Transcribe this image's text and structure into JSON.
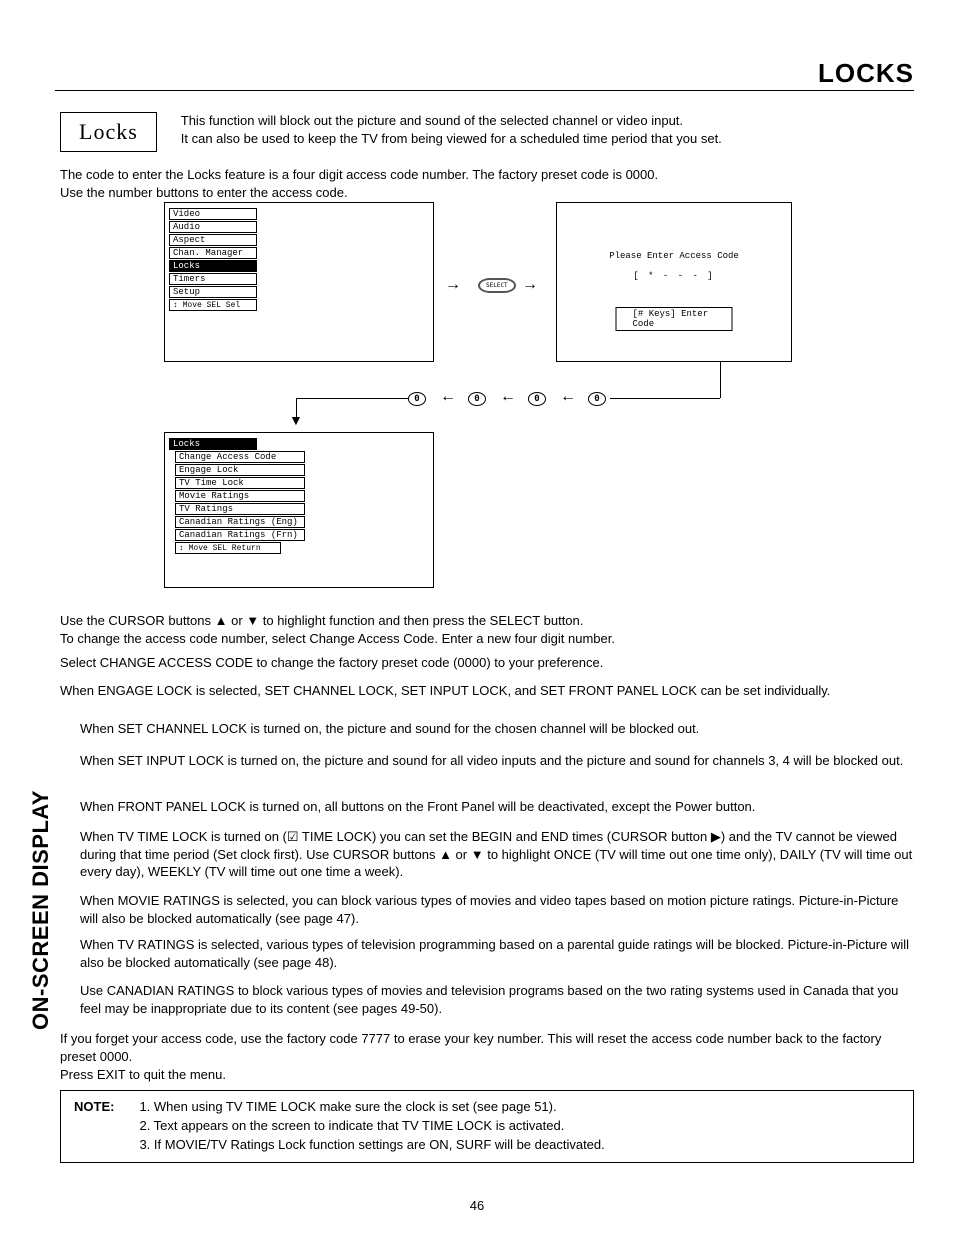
{
  "header": {
    "title": "LOCKS"
  },
  "sidebar": {
    "label": "ON-SCREEN DISPLAY"
  },
  "section": {
    "title": "Locks"
  },
  "intro": {
    "line1": "This function will block out the picture and sound of the selected channel or video input.",
    "line2": "It can also be used to keep the TV from being viewed for a scheduled time period that you set."
  },
  "para1": {
    "l1": "The code to enter the Locks feature is a four digit access code number.  The factory preset code is 0000.",
    "l2": "Use the number buttons to enter the access code."
  },
  "osd1": {
    "items": [
      "Video",
      "Audio",
      "Aspect",
      "Chan. Manager",
      "Locks",
      "Timers",
      "Setup"
    ],
    "hint": "↕ Move  SEL  Sel",
    "selected": "Locks"
  },
  "select_btn": "SELECT",
  "access_panel": {
    "prompt": "Please Enter Access Code",
    "mask": "[ * - - - ]",
    "hint": "[# Keys] Enter Code"
  },
  "zeros": [
    "0",
    "0",
    "0",
    "0"
  ],
  "osd2": {
    "title": "Locks",
    "items": [
      "Change Access Code",
      "Engage Lock",
      "TV Time Lock",
      "Movie Ratings",
      "TV Ratings",
      "Canadian Ratings (Eng)",
      "Canadian Ratings (Frn)"
    ],
    "hint": "↕ Move  SEL  Return"
  },
  "body": {
    "p2a": "Use the CURSOR buttons ▲ or ▼ to highlight function and then press the SELECT button.",
    "p2b": "To change the access code number, select Change Access Code.  Enter a new four digit number.",
    "p3": "Select CHANGE ACCESS CODE to change the factory preset code (0000) to your preference.",
    "p4": "When ENGAGE LOCK is selected, SET CHANNEL LOCK, SET INPUT LOCK, and SET FRONT PANEL LOCK can be set individually.",
    "p5": "When SET CHANNEL LOCK is turned on, the picture and sound for the chosen channel will be blocked out.",
    "p6": "When SET INPUT LOCK is turned on, the picture and sound for all video inputs and the picture and sound for channels 3, 4 will be blocked out.",
    "p7": "When FRONT PANEL LOCK is turned on, all buttons on the Front Panel will be deactivated, except the Power button.",
    "p8": "When TV TIME LOCK is turned on (☑ TIME LOCK) you can set the BEGIN and END times (CURSOR button ▶) and the TV cannot be viewed during that time period (Set clock first). Use CURSOR buttons ▲ or ▼ to highlight ONCE (TV will time out one time only), DAILY (TV will time out every day), WEEKLY (TV will time out one time a week).",
    "p9": "When MOVIE RATINGS is selected, you can block various types of movies and video tapes based on motion picture ratings.  Picture-in-Picture will also be blocked automatically (see page 47).",
    "p10": "When TV RATINGS is selected, various types of television programming based on a parental guide ratings will be blocked.  Picture-in-Picture will also be blocked automatically (see page 48).",
    "p11": "Use CANADIAN RATINGS to block various types of movies and television programs based on the two rating systems used in Canada that you feel may be inappropriate due to its content (see pages 49-50).",
    "p12": "If you forget your access code, use the factory code 7777 to erase your key number. This will reset the access code number back to the factory preset 0000.",
    "p13": "Press EXIT to quit the menu."
  },
  "note": {
    "label": "NOTE:",
    "n1": "1. When using TV TIME LOCK make sure the clock is set (see page 51).",
    "n2": "2. Text appears on the screen to indicate that TV TIME LOCK is activated.",
    "n3": "3. If MOVIE/TV Ratings Lock function settings are ON, SURF will be deactivated."
  },
  "page_number": "46"
}
